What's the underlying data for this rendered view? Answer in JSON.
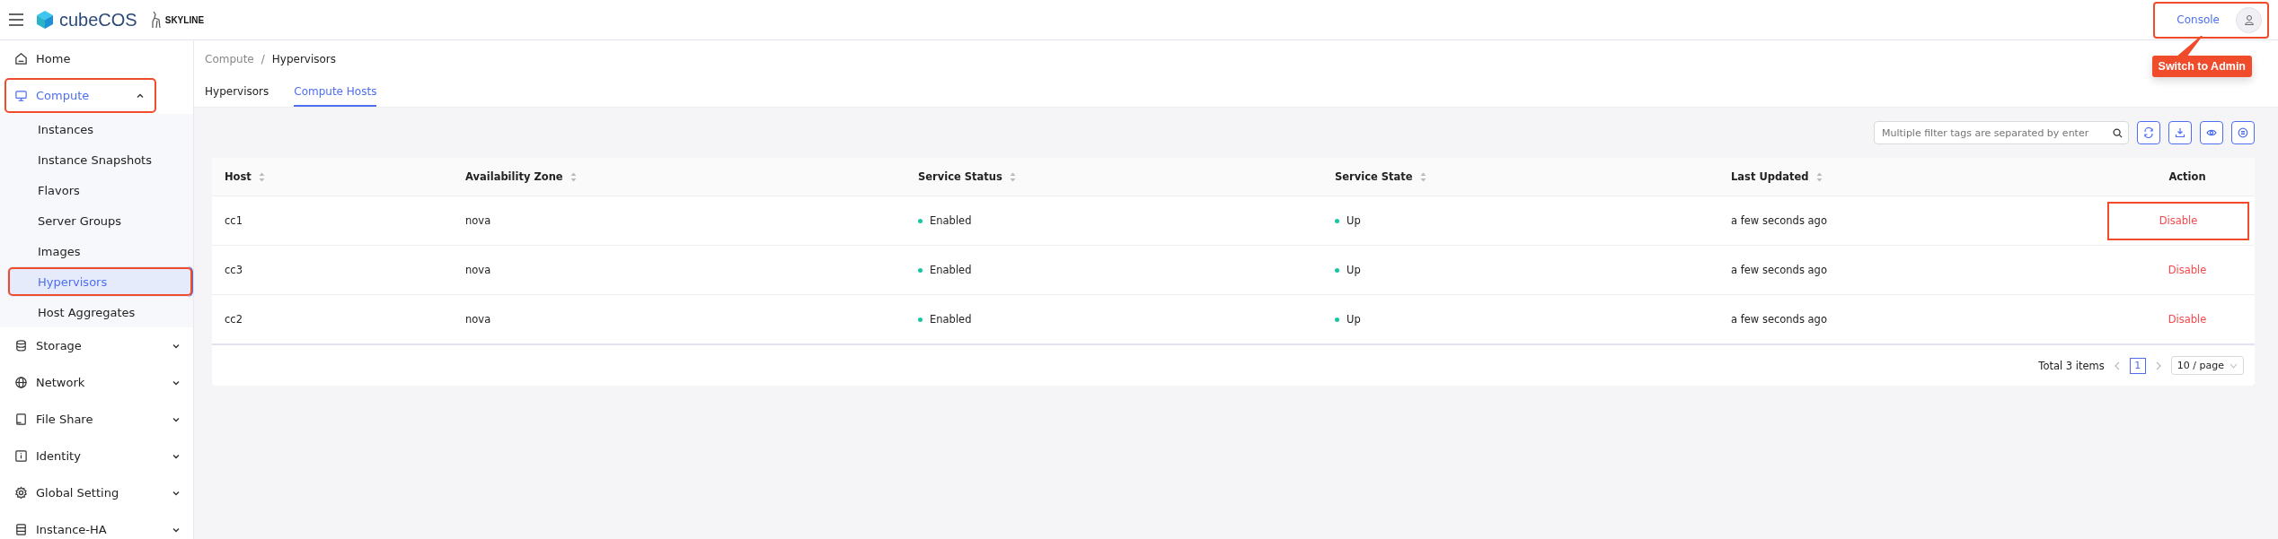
{
  "header": {
    "logo_text": "cubeCOS",
    "partner_text": "SKYLINE",
    "console_link": {
      "label": "Console",
      "annotated": true
    },
    "callout": "Switch to Admin"
  },
  "sidebar": {
    "items": [
      {
        "label": "Home",
        "kind": "link",
        "selected": false,
        "annotated": false
      },
      {
        "label": "Compute",
        "kind": "group",
        "selected": true,
        "expanded": true,
        "annotated": true,
        "children": [
          {
            "label": "Instances",
            "selected": false,
            "annotated": false
          },
          {
            "label": "Instance Snapshots",
            "selected": false,
            "annotated": false
          },
          {
            "label": "Flavors",
            "selected": false,
            "annotated": false
          },
          {
            "label": "Server Groups",
            "selected": false,
            "annotated": false
          },
          {
            "label": "Images",
            "selected": false,
            "annotated": false
          },
          {
            "label": "Hypervisors",
            "selected": true,
            "annotated": true
          },
          {
            "label": "Host Aggregates",
            "selected": false,
            "annotated": false
          }
        ]
      },
      {
        "label": "Storage",
        "kind": "group",
        "selected": false,
        "expanded": false,
        "annotated": false
      },
      {
        "label": "Network",
        "kind": "group",
        "selected": false,
        "expanded": false,
        "annotated": false
      },
      {
        "label": "File Share",
        "kind": "group",
        "selected": false,
        "expanded": false,
        "annotated": false
      },
      {
        "label": "Identity",
        "kind": "group",
        "selected": false,
        "expanded": false,
        "annotated": false
      },
      {
        "label": "Global Setting",
        "kind": "group",
        "selected": false,
        "expanded": false,
        "annotated": false
      },
      {
        "label": "Instance-HA",
        "kind": "group",
        "selected": false,
        "expanded": false,
        "annotated": false
      }
    ]
  },
  "breadcrumb": {
    "items": [
      "Compute",
      "Hypervisors"
    ],
    "separator": "/"
  },
  "tabs": [
    {
      "label": "Hypervisors",
      "selected": false
    },
    {
      "label": "Compute Hosts",
      "selected": true
    }
  ],
  "search": {
    "placeholder": "Multiple filter tags are separated by enter"
  },
  "table": {
    "columns": [
      "Host",
      "Availability Zone",
      "Service Status",
      "Service State",
      "Last Updated",
      "Action"
    ],
    "rows": [
      {
        "host": "cc1",
        "zone": "nova",
        "status": "Enabled",
        "state": "Up",
        "updated": "a few seconds ago",
        "action": "Disable",
        "annotated": true
      },
      {
        "host": "cc3",
        "zone": "nova",
        "status": "Enabled",
        "state": "Up",
        "updated": "a few seconds ago",
        "action": "Disable",
        "annotated": false
      },
      {
        "host": "cc2",
        "zone": "nova",
        "status": "Enabled",
        "state": "Up",
        "updated": "a few seconds ago",
        "action": "Disable",
        "annotated": false
      }
    ]
  },
  "pagination": {
    "total": "Total 3 items",
    "pages": [
      {
        "label": "1",
        "selected": true
      }
    ],
    "page_size": "10 / page"
  }
}
